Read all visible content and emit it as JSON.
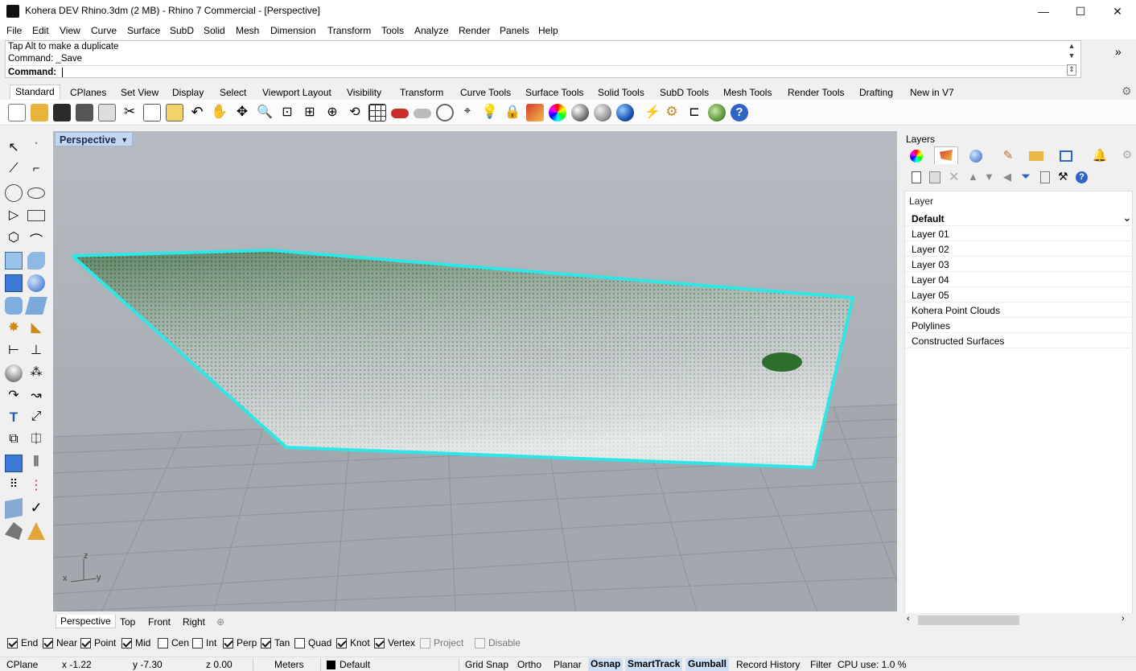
{
  "window": {
    "title": "Kohera DEV Rhino.3dm (2 MB) - Rhino 7 Commercial - [Perspective]",
    "minimize": "—",
    "maximize": "☐",
    "close": "✕"
  },
  "menu": [
    "File",
    "Edit",
    "View",
    "Curve",
    "Surface",
    "SubD",
    "Solid",
    "Mesh",
    "Dimension",
    "Transform",
    "Tools",
    "Analyze",
    "Render",
    "Panels",
    "Help"
  ],
  "command": {
    "line1": "Tap Alt to make a duplicate",
    "line2": "Command: _Save",
    "prompt": "Command:",
    "value": "",
    "expand_icon": "»"
  },
  "toolbar_tabs": [
    "Standard",
    "CPlanes",
    "Set View",
    "Display",
    "Select",
    "Viewport Layout",
    "Visibility",
    "Transform",
    "Curve Tools",
    "Surface Tools",
    "Solid Tools",
    "SubD Tools",
    "Mesh Tools",
    "Render Tools",
    "Drafting",
    "New in V7"
  ],
  "viewport": {
    "name": "Perspective",
    "dropdown": "▼",
    "axes": {
      "z": "z",
      "x": "x",
      "y": "y"
    }
  },
  "viewport_tabs": [
    "Perspective",
    "Top",
    "Front",
    "Right",
    "⊕"
  ],
  "layers_panel": {
    "title": "Layers",
    "column_header": "Layer",
    "layers": [
      "Default",
      "Layer 01",
      "Layer 02",
      "Layer 03",
      "Layer 04",
      "Layer 05",
      "Kohera Point Clouds",
      "Polylines",
      "Constructed Surfaces"
    ],
    "current": "Default",
    "chevron": "⌄"
  },
  "osnaps": [
    {
      "label": "End",
      "checked": true
    },
    {
      "label": "Near",
      "checked": true
    },
    {
      "label": "Point",
      "checked": true
    },
    {
      "label": "Mid",
      "checked": true
    },
    {
      "label": "Cen",
      "checked": false
    },
    {
      "label": "Int",
      "checked": false
    },
    {
      "label": "Perp",
      "checked": true
    },
    {
      "label": "Tan",
      "checked": true
    },
    {
      "label": "Quad",
      "checked": false
    },
    {
      "label": "Knot",
      "checked": true
    },
    {
      "label": "Vertex",
      "checked": true
    },
    {
      "label": "Project",
      "checked": false,
      "disabled": true
    },
    {
      "label": "Disable",
      "checked": false,
      "disabled": true
    }
  ],
  "status": {
    "cplane": "CPlane",
    "x": "x -1.22",
    "y": "y -7.30",
    "z": "z 0.00",
    "units": "Meters",
    "layer": "Default",
    "grid_snap": "Grid Snap",
    "ortho": "Ortho",
    "planar": "Planar",
    "osnap": "Osnap",
    "smarttrack": "SmartTrack",
    "gumball": "Gumball",
    "record_history": "Record History",
    "filter": "Filter",
    "cpu": "CPU use: 1.0 %"
  },
  "colors": {
    "selection_outline": "#2fe6e6",
    "point_cloud": "#2d6e2d",
    "active_layer_swatch": "#000000",
    "status_on": "#cfe0f6"
  }
}
